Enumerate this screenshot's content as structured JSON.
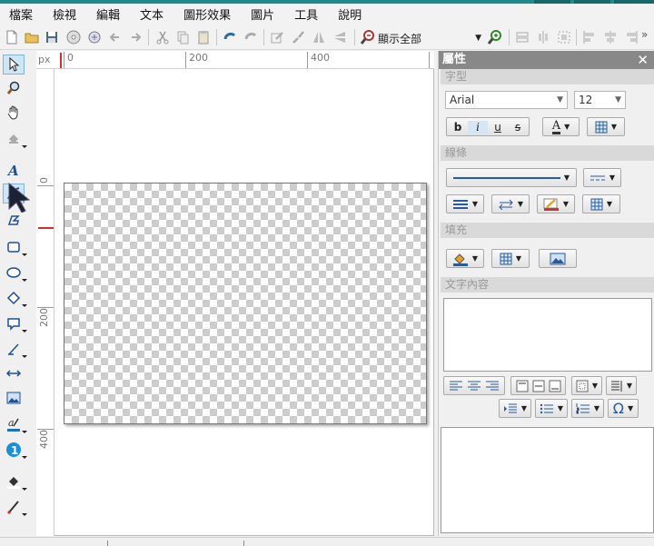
{
  "menu": [
    "檔案",
    "檢視",
    "編輯",
    "文本",
    "圖形效果",
    "圖片",
    "工具",
    "說明"
  ],
  "toolbar": {
    "zoom_value": "顯示全部",
    "more": "»",
    "icons": [
      "new-file-icon",
      "open-folder-icon",
      "save-icon",
      "disc-icon",
      "refresh-icon",
      "undo-icon",
      "redo-icon",
      "cut-icon",
      "copy-icon",
      "paste-icon",
      "rotate-left-icon",
      "rotate-right-icon",
      "edit-icon",
      "brush-icon",
      "flip-horizontal-icon",
      "flip-vertical-icon",
      "zoom-out-icon",
      "zoom-in-icon"
    ]
  },
  "ruler": {
    "unit": "px",
    "top_ticks": [
      "0",
      "200",
      "400"
    ],
    "left_ticks": [
      "0",
      "200",
      "400"
    ]
  },
  "left_tools": [
    "select-arrow-icon",
    "zoom-icon",
    "hand-pan-icon",
    "fill-bucket-icon",
    "text-tool-icon",
    "pen-tool-icon",
    "polygon-tool-icon",
    "rectangle-tool-icon",
    "ellipse-tool-icon",
    "diamond-tool-icon",
    "callout-tool-icon",
    "dimension-tool-icon",
    "arrow-connector-icon",
    "image-tool-icon",
    "text-color-icon",
    "number-badge-icon",
    "fill-color-icon",
    "line-color-icon"
  ],
  "properties": {
    "title": "屬性",
    "close": "✕",
    "font_section": "字型",
    "font_family": "Arial",
    "font_size": "12",
    "bold": "b",
    "italic": "i",
    "underline": "u",
    "strike": "s",
    "text_color_label": "A",
    "line_section": "線條",
    "fill_section": "填充",
    "text_section": "文字內容",
    "omega": "Ω"
  },
  "colors": {
    "accent": "#1e8a8c",
    "panel_header": "#888888",
    "section_header": "#d9d9d9",
    "ruler_marker": "#d23030"
  }
}
